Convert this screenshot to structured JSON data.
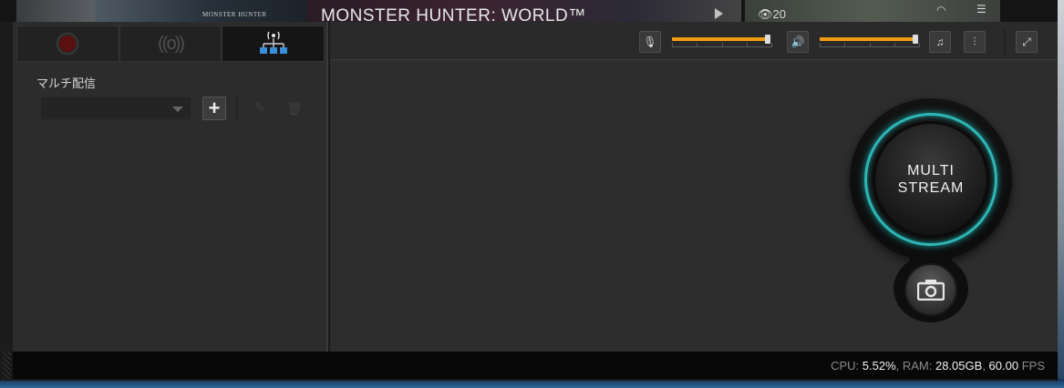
{
  "top_strip": {
    "game_logo": "MONSTER HUNTER",
    "game_title": "MONSTER HUNTER: WORLD™",
    "view_count": "20"
  },
  "left_panel": {
    "tabs": [
      {
        "id": "record",
        "icon": "record-icon"
      },
      {
        "id": "broadcast",
        "icon": "broadcast-icon"
      },
      {
        "id": "multistream",
        "icon": "multistream-network-icon",
        "active": true
      }
    ],
    "section_label": "マルチ配信",
    "profile_select": {
      "value": ""
    }
  },
  "toolbar": {
    "mic_volume": 1.0,
    "speaker_volume": 1.0
  },
  "stream_button": {
    "line1": "MULTI",
    "line2": "STREAM"
  },
  "status": {
    "cpu_label": "CPU: ",
    "cpu_value": "5.52%",
    "ram_label": ", RAM: ",
    "ram_value": "28.05GB",
    "sep": ", ",
    "fps_value": "60.00",
    "fps_label": " FPS"
  },
  "colors": {
    "accent": "#f39c12",
    "stream_ring": "#2fb5b5",
    "record": "#5a1010"
  }
}
